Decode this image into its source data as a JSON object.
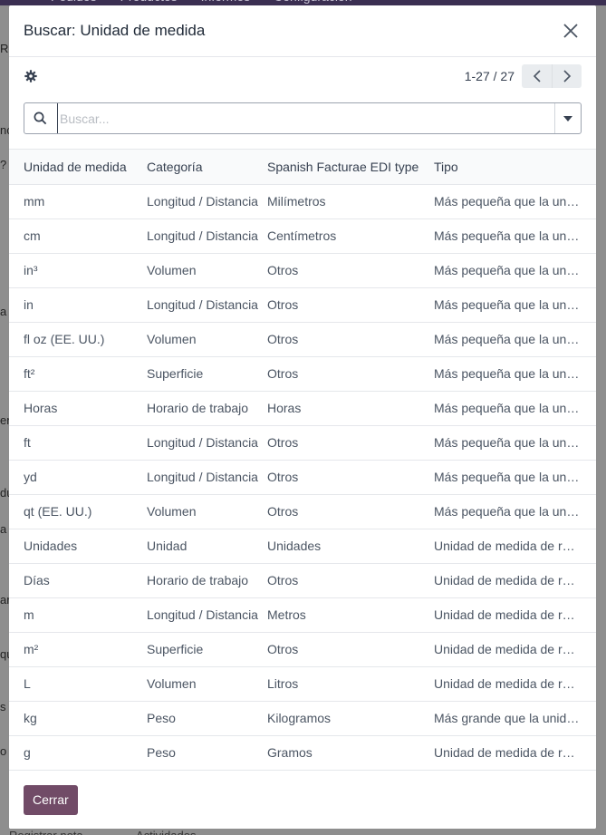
{
  "background": {
    "topbar": [
      "Pedidos",
      "Productos",
      "Informes",
      "Configuración"
    ],
    "side": [
      "Rc",
      "nc",
      "?",
      "a",
      "en",
      "du",
      "a",
      "ar",
      "qu",
      "s",
      "o p"
    ],
    "bottom": [
      "Registrar nota",
      "Actividades"
    ]
  },
  "dialog": {
    "title": "Buscar: Unidad de medida",
    "pager": "1-27 / 27",
    "search_placeholder": "Buscar...",
    "close_button": "Cerrar"
  },
  "table": {
    "columns": [
      "Unidad de medida",
      "Categoría",
      "Spanish Facturae EDI type",
      "Tipo"
    ],
    "rows": [
      [
        "mm",
        "Longitud / Distancia",
        "Milímetros",
        "Más pequeña que la unidad de medida de referencia"
      ],
      [
        "cm",
        "Longitud / Distancia",
        "Centímetros",
        "Más pequeña que la unidad de medida de referencia"
      ],
      [
        "in³",
        "Volumen",
        "Otros",
        "Más pequeña que la unidad de medida de referencia"
      ],
      [
        "in",
        "Longitud / Distancia",
        "Otros",
        "Más pequeña que la unidad de medida de referencia"
      ],
      [
        "fl oz (EE. UU.)",
        "Volumen",
        "Otros",
        "Más pequeña que la unidad de medida de referencia"
      ],
      [
        "ft²",
        "Superficie",
        "Otros",
        "Más pequeña que la unidad de medida de referencia"
      ],
      [
        "Horas",
        "Horario de trabajo",
        "Horas",
        "Más pequeña que la unidad de medida de referencia"
      ],
      [
        "ft",
        "Longitud / Distancia",
        "Otros",
        "Más pequeña que la unidad de medida de referencia"
      ],
      [
        "yd",
        "Longitud / Distancia",
        "Otros",
        "Más pequeña que la unidad de medida de referencia"
      ],
      [
        "qt (EE. UU.)",
        "Volumen",
        "Otros",
        "Más pequeña que la unidad de medida de referencia"
      ],
      [
        "Unidades",
        "Unidad",
        "Unidades",
        "Unidad de medida de referencia para esta categoría"
      ],
      [
        "Días",
        "Horario de trabajo",
        "Otros",
        "Unidad de medida de referencia para esta categoría"
      ],
      [
        "m",
        "Longitud / Distancia",
        "Metros",
        "Unidad de medida de referencia para esta categoría"
      ],
      [
        "m²",
        "Superficie",
        "Otros",
        "Unidad de medida de referencia para esta categoría"
      ],
      [
        "L",
        "Volumen",
        "Litros",
        "Unidad de medida de referencia para esta categoría"
      ],
      [
        "kg",
        "Peso",
        "Kilogramos",
        "Más grande que la unidad de medida de referencia"
      ],
      [
        "g",
        "Peso",
        "Gramos",
        "Unidad de medida de referencia para esta categoría"
      ],
      [
        "",
        "",
        "",
        ""
      ]
    ]
  },
  "colors": {
    "primary": "#714b67",
    "topbar": "#3b2f52"
  }
}
